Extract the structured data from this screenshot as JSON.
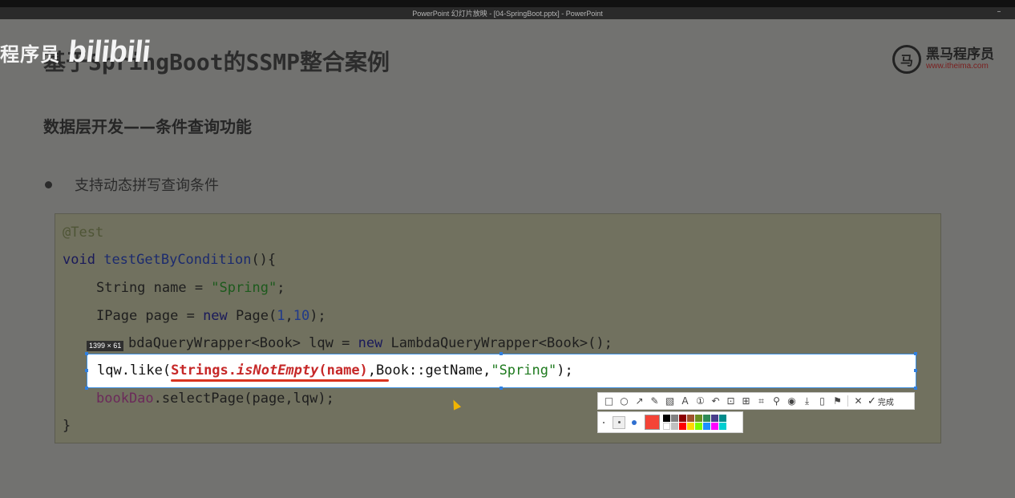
{
  "window": {
    "title": "PowerPoint 幻灯片放映 - [04-SpringBoot.pptx] - PowerPoint",
    "min_label": "–"
  },
  "watermark": {
    "text": "程序员",
    "logo": "bilibili"
  },
  "slide": {
    "title": "基于SpringBoot的SSMP整合案例",
    "subtitle": "数据层开发——条件查询功能",
    "bullet": "支持动态拼写查询条件"
  },
  "brand": {
    "icon": "horse-logo-icon",
    "glyph": "马",
    "name": "黑马程序员",
    "url": "www.itheima.com"
  },
  "code": {
    "annotation": "@Test",
    "line2_kw": "void",
    "line2_fn": "testGetByCondition",
    "line2_rest": "(){",
    "line3_a": "String name = ",
    "line3_str": "\"Spring\"",
    "line3_b": ";",
    "line4_a": "IPage page = ",
    "line4_kw": "new",
    "line4_b": " Page(",
    "line4_n1": "1",
    "line4_c": ",",
    "line4_n2": "10",
    "line4_d": ");",
    "line5_a": "bdaQueryWrapper<Book> lqw = ",
    "line5_kw": "new",
    "line5_b": " LambdaQueryWrapper<Book>();",
    "line6_a": "lqw.like(",
    "line6_hl1": "Strings.",
    "line6_hl2": "isNotEmpty",
    "line6_hl3": "(name)",
    "line6_b": ",Book::getName,",
    "line6_str": "\"Spring\"",
    "line6_c": ");",
    "line7_fld": "bookDao",
    "line7_rest": ".selectPage(page,lqw);",
    "line8": "}"
  },
  "screenshot_tool": {
    "dimensions": "1399 × 61",
    "tools": [
      {
        "name": "rectangle-icon",
        "glyph": "□"
      },
      {
        "name": "ellipse-icon",
        "glyph": "○"
      },
      {
        "name": "arrow-icon",
        "glyph": "↗"
      },
      {
        "name": "pen-icon",
        "glyph": "✎"
      },
      {
        "name": "mosaic-icon",
        "glyph": "▧"
      },
      {
        "name": "text-icon",
        "glyph": "A"
      },
      {
        "name": "number-icon",
        "glyph": "①"
      },
      {
        "name": "undo-icon",
        "glyph": "↶"
      },
      {
        "name": "ocr-icon",
        "glyph": "⊡"
      },
      {
        "name": "translate-icon",
        "glyph": "⊞"
      },
      {
        "name": "scan-icon",
        "glyph": "⌗"
      },
      {
        "name": "pin-icon",
        "glyph": "⚲"
      },
      {
        "name": "record-icon",
        "glyph": "◉"
      },
      {
        "name": "download-icon",
        "glyph": "⤓"
      },
      {
        "name": "phone-icon",
        "glyph": "▯"
      },
      {
        "name": "bookmark-icon",
        "glyph": "⚑"
      },
      {
        "name": "close-icon",
        "glyph": "✕"
      }
    ],
    "done_label": "完成",
    "current_color": "#f44336",
    "swatches": [
      "#000000",
      "#808080",
      "#8b0000",
      "#a0522d",
      "#6b8e23",
      "#2e8b57",
      "#483d8b",
      "#008b8b",
      "#ffffff",
      "#c0c0c0",
      "#ff0000",
      "#ffd700",
      "#7cfc00",
      "#1e90ff",
      "#ff00ff",
      "#00ced1"
    ]
  }
}
